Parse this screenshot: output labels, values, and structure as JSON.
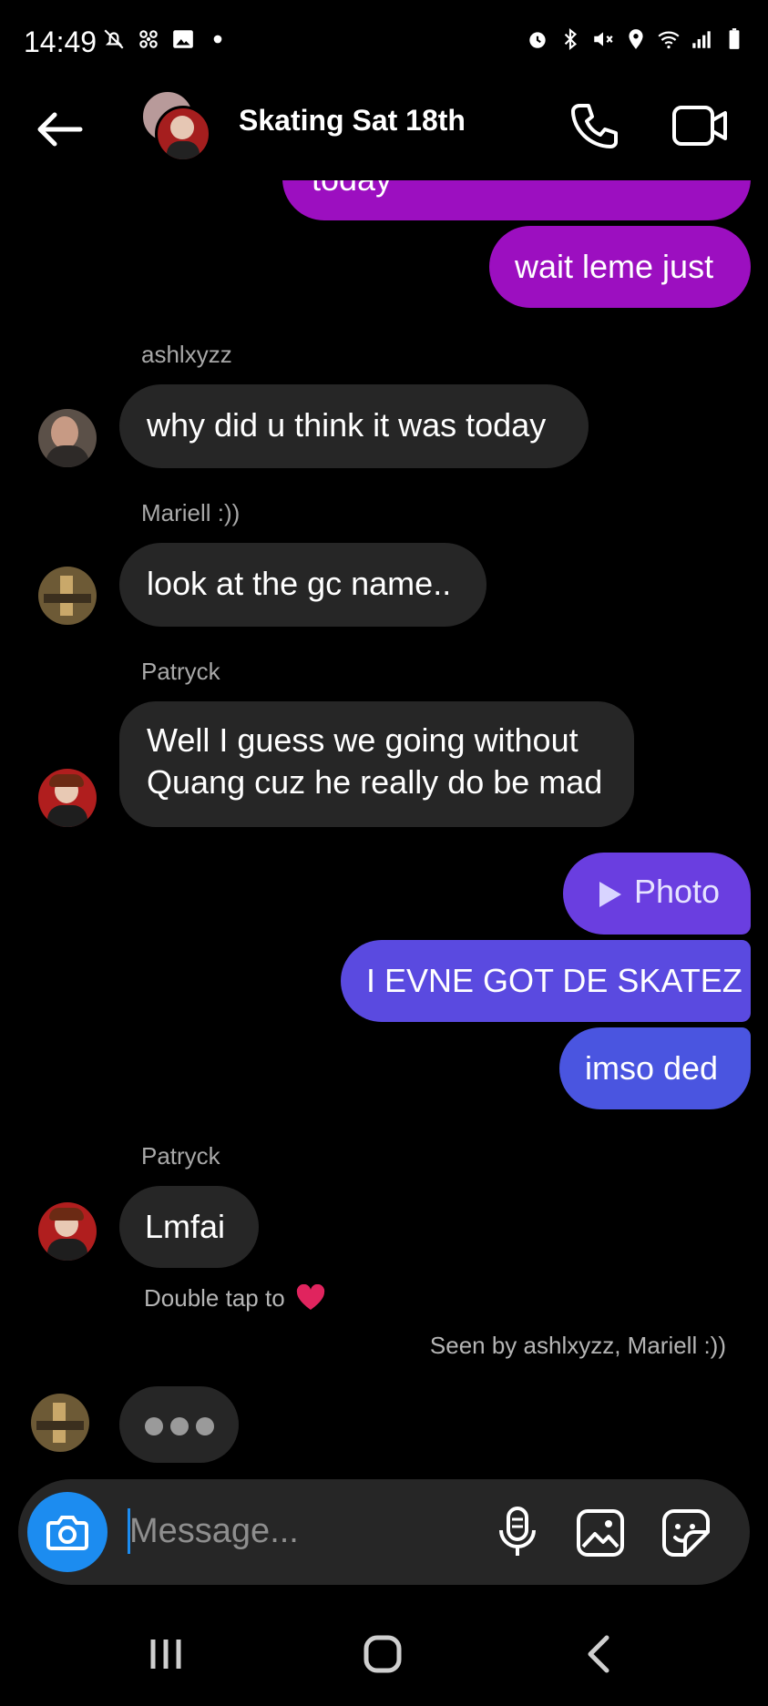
{
  "status_bar": {
    "time": "14:49",
    "icons_left": [
      "notifications-off-icon",
      "fan-icon",
      "gallery-icon",
      "dot-icon"
    ],
    "icons_right": [
      "alarm-icon",
      "bluetooth-icon",
      "mute-icon",
      "location-icon",
      "wifi-icon",
      "signal-icon",
      "battery-icon"
    ]
  },
  "header": {
    "title": "Skating Sat 18th",
    "back_icon": "back-arrow-icon",
    "call_icon": "phone-icon",
    "video_icon": "video-camera-icon"
  },
  "messages": {
    "out_1_partial": "today",
    "out_2": "wait leme just",
    "in_1_sender": "ashlxyzz",
    "in_1_text": "why did u think it was today",
    "in_2_sender": "Mariell :))",
    "in_2_text": "look at the gc name..",
    "in_3_sender": "Patryck",
    "in_3_line1": "Well I guess we going without",
    "in_3_line2": "Quang cuz he really do be mad",
    "out_photo": "Photo",
    "out_3": "I EVNE GOT DE SKATEZ",
    "out_4": "imso ded",
    "in_4_sender": "Patryck",
    "in_4_text": "Lmfai",
    "double_tap": "Double tap to",
    "seen_by": "Seen by ashlxyzz, Mariell :))"
  },
  "composer": {
    "placeholder": "Message...",
    "icons": [
      "camera-icon",
      "microphone-icon",
      "gallery-icon",
      "sticker-icon"
    ]
  },
  "nav_bar": {
    "icons": [
      "recent-apps-icon",
      "home-icon",
      "back-icon"
    ]
  },
  "colors": {
    "background": "#000000",
    "incoming_bubble": "#262626",
    "outgoing_purple": "#9c0fc0",
    "outgoing_violet": "#6a3ee0",
    "outgoing_blue": "#4a55e0",
    "camera_button": "#1c8cf0",
    "heart": "#e0245e"
  }
}
